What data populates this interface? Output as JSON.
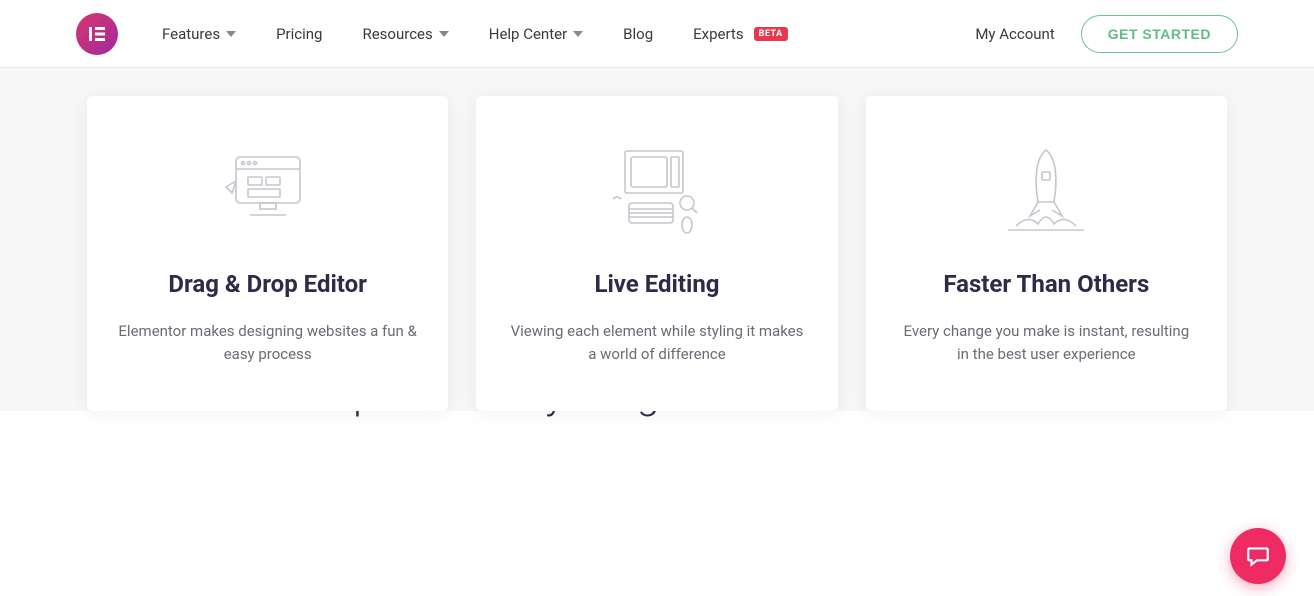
{
  "nav": {
    "items": [
      {
        "label": "Features",
        "dropdown": true
      },
      {
        "label": "Pricing",
        "dropdown": false
      },
      {
        "label": "Resources",
        "dropdown": true
      },
      {
        "label": "Help Center",
        "dropdown": true
      },
      {
        "label": "Blog",
        "dropdown": false
      },
      {
        "label": "Experts",
        "dropdown": false,
        "badge": "BETA"
      }
    ],
    "account": "My Account",
    "cta": "GET STARTED"
  },
  "cards": [
    {
      "title": "Drag & Drop Editor",
      "desc": "Elementor makes designing websites a fun & easy process"
    },
    {
      "title": "Live Editing",
      "desc": "Viewing each element while styling it makes a world of difference"
    },
    {
      "title": "Faster Than Others",
      "desc": "Every change you make is instant, resulting in the best user experience"
    }
  ],
  "workflow_heading": "Improve Every Stage of Your Workflow"
}
